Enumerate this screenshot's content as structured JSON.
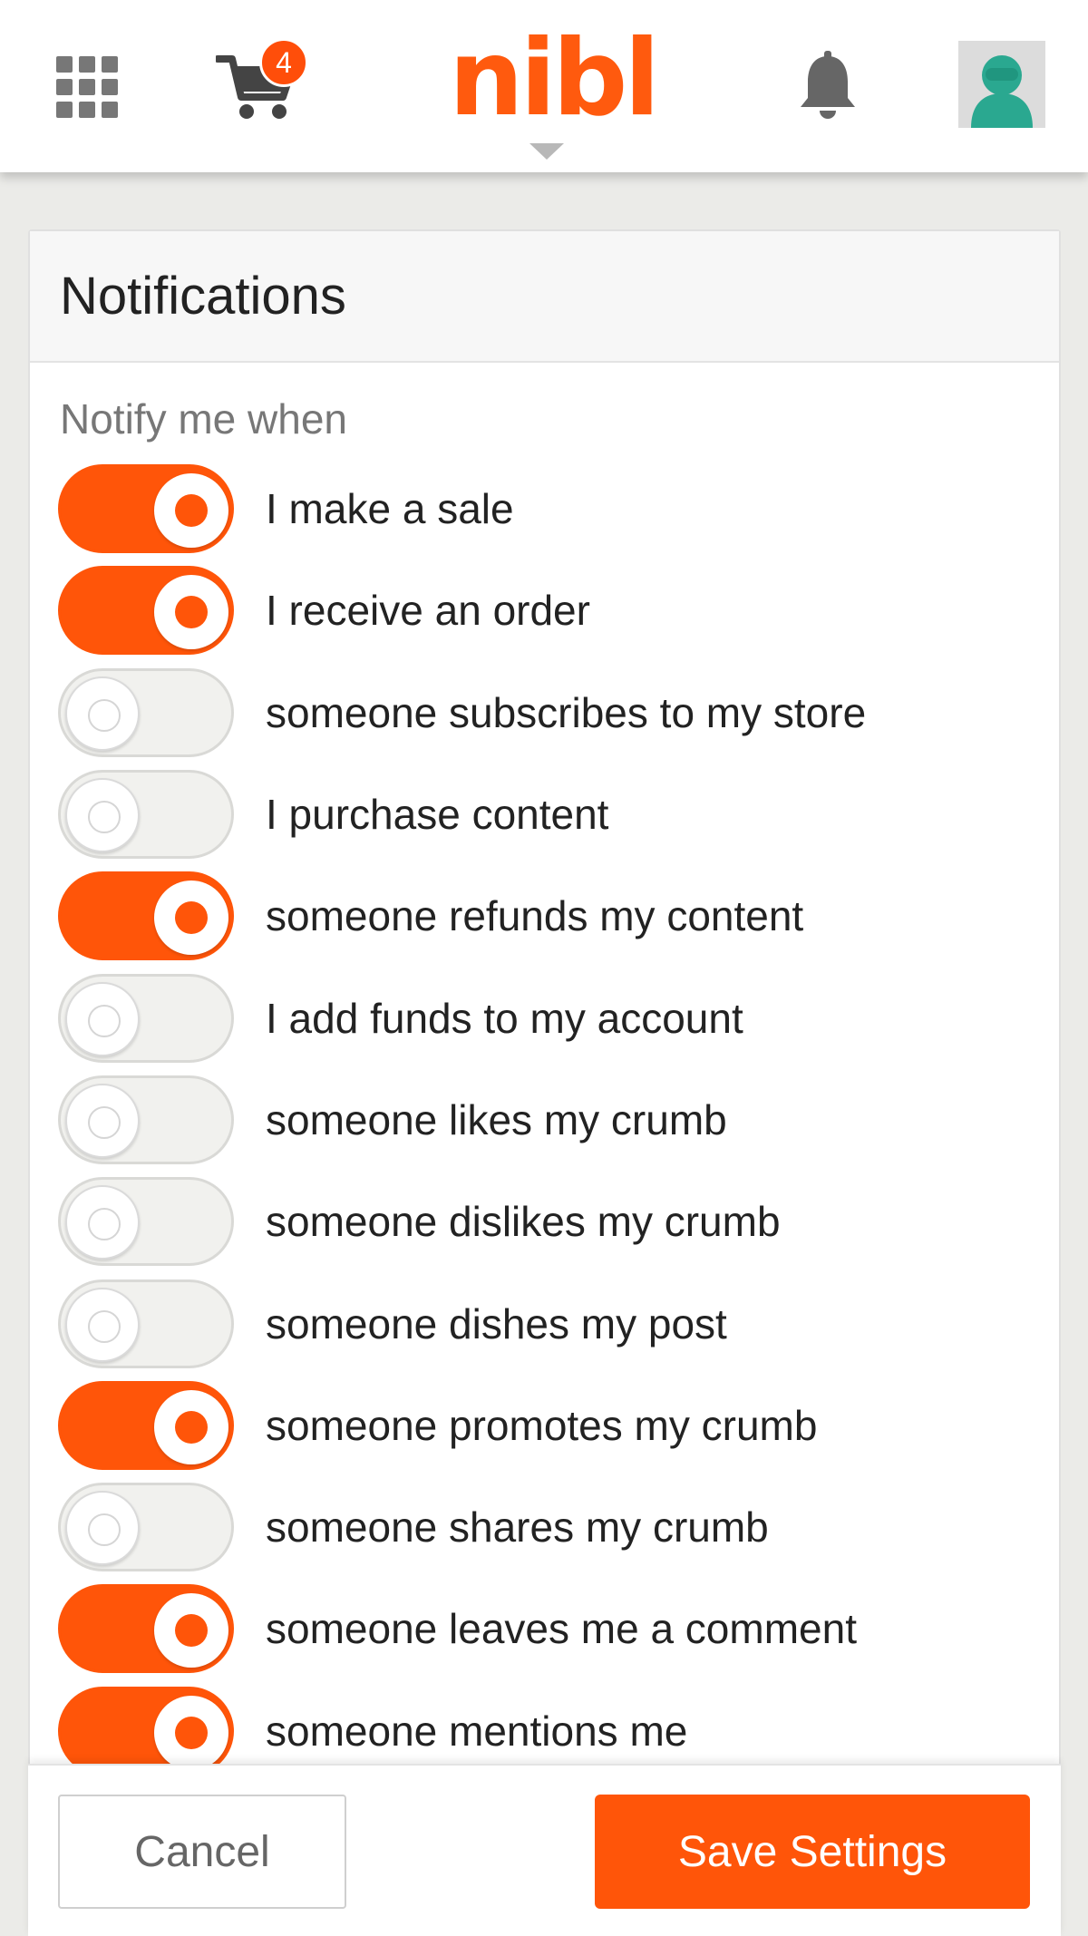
{
  "header": {
    "logo_text": "nibl",
    "cart_count": "4",
    "icons": [
      "apps-grid-icon",
      "cart-icon",
      "bell-icon",
      "user-avatar-icon"
    ],
    "brand_color": "#ff5509"
  },
  "card": {
    "title": "Notifications",
    "section_label": "Notify me when"
  },
  "settings": [
    {
      "label": "I make a sale",
      "on": true
    },
    {
      "label": "I receive an order",
      "on": true
    },
    {
      "label": "someone subscribes to my store",
      "on": false
    },
    {
      "label": "I purchase content",
      "on": false
    },
    {
      "label": "someone refunds my content",
      "on": true
    },
    {
      "label": "I add funds to my account",
      "on": false
    },
    {
      "label": "someone likes my crumb",
      "on": false
    },
    {
      "label": "someone dislikes my crumb",
      "on": false
    },
    {
      "label": "someone dishes my post",
      "on": false
    },
    {
      "label": "someone promotes my crumb",
      "on": true
    },
    {
      "label": "someone shares my crumb",
      "on": false
    },
    {
      "label": "someone leaves me a comment",
      "on": true
    },
    {
      "label": "someone mentions me",
      "on": true
    }
  ],
  "footer": {
    "cancel_label": "Cancel",
    "save_label": "Save Settings"
  }
}
